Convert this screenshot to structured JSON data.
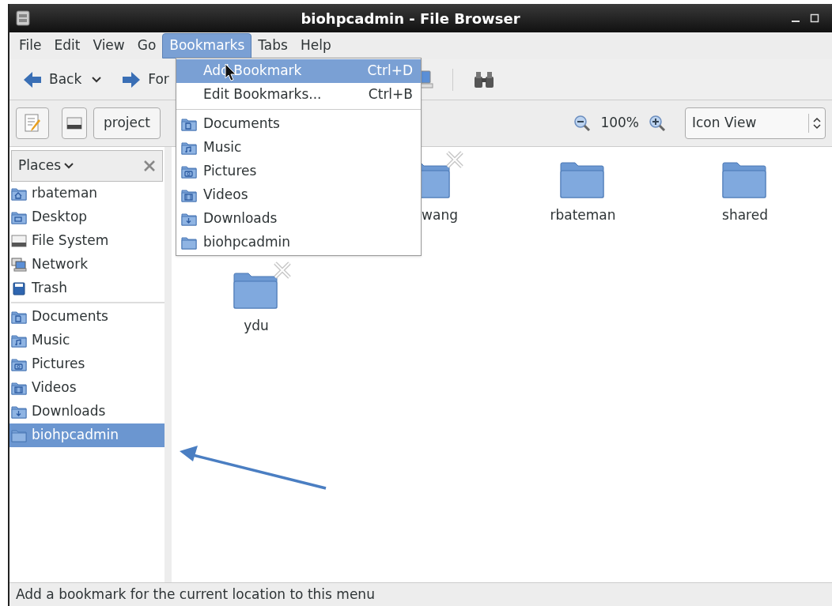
{
  "window": {
    "title": "biohpcadmin - File Browser"
  },
  "menubar": [
    {
      "label": "File",
      "selected": false
    },
    {
      "label": "Edit",
      "selected": false
    },
    {
      "label": "View",
      "selected": false
    },
    {
      "label": "Go",
      "selected": false
    },
    {
      "label": "Bookmarks",
      "selected": true
    },
    {
      "label": "Tabs",
      "selected": false
    },
    {
      "label": "Help",
      "selected": false
    }
  ],
  "toolbar": {
    "back": "Back",
    "forward": "For"
  },
  "location_bar": {
    "path_button": "project",
    "zoom": "100%",
    "view_mode": "Icon View"
  },
  "sidebar": {
    "header": "Places",
    "groups": [
      [
        {
          "label": "rbateman",
          "kind": "home",
          "selected": false
        },
        {
          "label": "Desktop",
          "kind": "desktop",
          "selected": false
        },
        {
          "label": "File System",
          "kind": "drive",
          "selected": false
        },
        {
          "label": "Network",
          "kind": "network",
          "selected": false
        },
        {
          "label": "Trash",
          "kind": "trash",
          "selected": false
        }
      ],
      [
        {
          "label": "Documents",
          "kind": "documents",
          "selected": false
        },
        {
          "label": "Music",
          "kind": "music",
          "selected": false
        },
        {
          "label": "Pictures",
          "kind": "pictures",
          "selected": false
        },
        {
          "label": "Videos",
          "kind": "videos",
          "selected": false
        },
        {
          "label": "Downloads",
          "kind": "downloads",
          "selected": false
        },
        {
          "label": "biohpcadmin",
          "kind": "folder",
          "selected": true
        }
      ]
    ]
  },
  "files": [
    {
      "label": "wang",
      "locked": true,
      "partial": true
    },
    {
      "label": "rbateman",
      "locked": false,
      "partial": false
    },
    {
      "label": "shared",
      "locked": false,
      "partial": false
    },
    {
      "label": "ydu",
      "locked": true,
      "partial": false
    }
  ],
  "bookmarks_menu": {
    "actions": [
      {
        "label": "Add Bookmark",
        "shortcut": "Ctrl+D",
        "selected": true
      },
      {
        "label": "Edit Bookmarks...",
        "shortcut": "Ctrl+B",
        "selected": false
      }
    ],
    "bookmarks": [
      {
        "label": "Documents",
        "kind": "documents"
      },
      {
        "label": "Music",
        "kind": "music"
      },
      {
        "label": "Pictures",
        "kind": "pictures"
      },
      {
        "label": "Videos",
        "kind": "videos"
      },
      {
        "label": "Downloads",
        "kind": "downloads"
      },
      {
        "label": "biohpcadmin",
        "kind": "folder"
      }
    ]
  },
  "status_bar": "Add a bookmark for the current location to this menu"
}
